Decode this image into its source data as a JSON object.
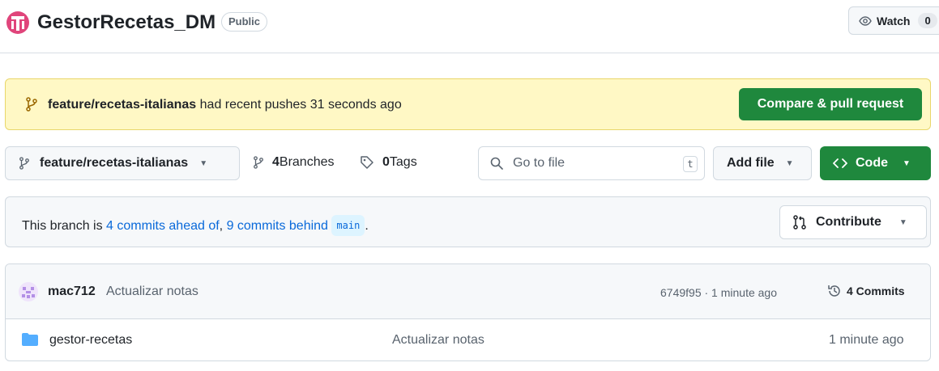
{
  "repo": {
    "name": "GestorRecetas_DM",
    "visibility": "Public",
    "watch_label": "Watch",
    "watch_count": "0"
  },
  "banner": {
    "branch": "feature/recetas-italianas",
    "message": " had recent pushes 31 seconds ago",
    "button": "Compare & pull request"
  },
  "toolbar": {
    "branch_name": "feature/recetas-italianas",
    "branches_count": "4",
    "branches_label": " Branches",
    "tags_count": "0",
    "tags_label": " Tags",
    "search_placeholder": "Go to file",
    "search_shortcut": "t",
    "add_file": "Add file",
    "code": "Code"
  },
  "status": {
    "prefix": "This branch is ",
    "ahead": "4 commits ahead of",
    "sep": ", ",
    "behind": "9 commits behind",
    "base_branch": "main",
    "suffix": ".",
    "contribute": "Contribute"
  },
  "latest_commit": {
    "author": "mac712",
    "message": "Actualizar notas",
    "hash_time": "6749f95 · 1 minute ago",
    "commits_label": "4 Commits"
  },
  "files": [
    {
      "name": "gestor-recetas",
      "commit": "Actualizar notas",
      "age": "1 minute ago"
    }
  ],
  "colors": {
    "accent_green": "#1f883d",
    "link_blue": "#0969da",
    "banner_yellow": "#fff8c5",
    "avatar_pink": "#e0457b"
  }
}
